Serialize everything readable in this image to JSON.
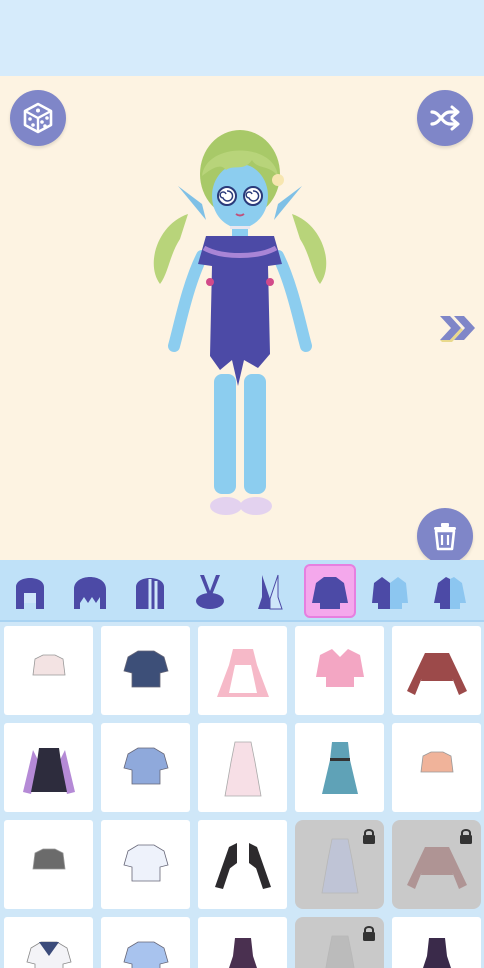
{
  "toolbar": {
    "dice_icon": "dice-icon",
    "shuffle_icon": "shuffle-icon",
    "trash_icon": "trash-icon",
    "next_icon": "double-chevron-right-icon",
    "accent_color": "#7f86c8"
  },
  "categories": [
    {
      "name": "hair-front",
      "icon": "hair-front-icon",
      "active": false
    },
    {
      "name": "hair-bangs",
      "icon": "hair-bangs-icon",
      "active": false
    },
    {
      "name": "hair-back",
      "icon": "hair-back-icon",
      "active": false
    },
    {
      "name": "bunny-ears",
      "icon": "bunny-ears-icon",
      "active": false
    },
    {
      "name": "half-ears",
      "icon": "half-ears-icon",
      "active": false
    },
    {
      "name": "tops",
      "icon": "sweater-icon",
      "active": true
    },
    {
      "name": "outer",
      "icon": "jacket-icon",
      "active": false
    },
    {
      "name": "half-top",
      "icon": "half-shirt-icon",
      "active": false
    }
  ],
  "items": [
    {
      "kind": "crop-top",
      "color": "#f3e3e3",
      "locked": false
    },
    {
      "kind": "shirt",
      "color": "#3d4f78",
      "locked": false
    },
    {
      "kind": "maid-dress",
      "color": "#f6b9c8",
      "locked": false
    },
    {
      "kind": "cardigan",
      "color": "#f3a6c3",
      "locked": false
    },
    {
      "kind": "long-sleeve",
      "color": "#9c4a4a",
      "locked": false
    },
    {
      "kind": "pinafore",
      "color": "#2d2c3d",
      "locked": false
    },
    {
      "kind": "blouse",
      "color": "#8fa9db",
      "locked": false
    },
    {
      "kind": "polka-dress",
      "color": "#f7dfe6",
      "locked": false
    },
    {
      "kind": "school-dress",
      "color": "#5fa2b7",
      "locked": false
    },
    {
      "kind": "bow-top",
      "color": "#f0b39a",
      "locked": false
    },
    {
      "kind": "crop-tee",
      "color": "#6b6b6b",
      "locked": false
    },
    {
      "kind": "tie-shirt",
      "color": "#eef2fb",
      "locked": false
    },
    {
      "kind": "bolero",
      "color": "#2c2a2d",
      "locked": false
    },
    {
      "kind": "slip-dress",
      "color": "#b8c1e2",
      "locked": true
    },
    {
      "kind": "off-shoulder",
      "color": "#9a6a6a",
      "locked": true
    },
    {
      "kind": "sailor",
      "color": "#3b4b7a",
      "locked": false
    },
    {
      "kind": "ribbon-blouse",
      "color": "#a8c3ee",
      "locked": false
    },
    {
      "kind": "dark-dress",
      "color": "#4a3050",
      "locked": false
    },
    {
      "kind": "halter",
      "color": "#b0b0b0",
      "locked": true
    },
    {
      "kind": "gothic-dress",
      "color": "#3a2a4a",
      "locked": false
    }
  ]
}
